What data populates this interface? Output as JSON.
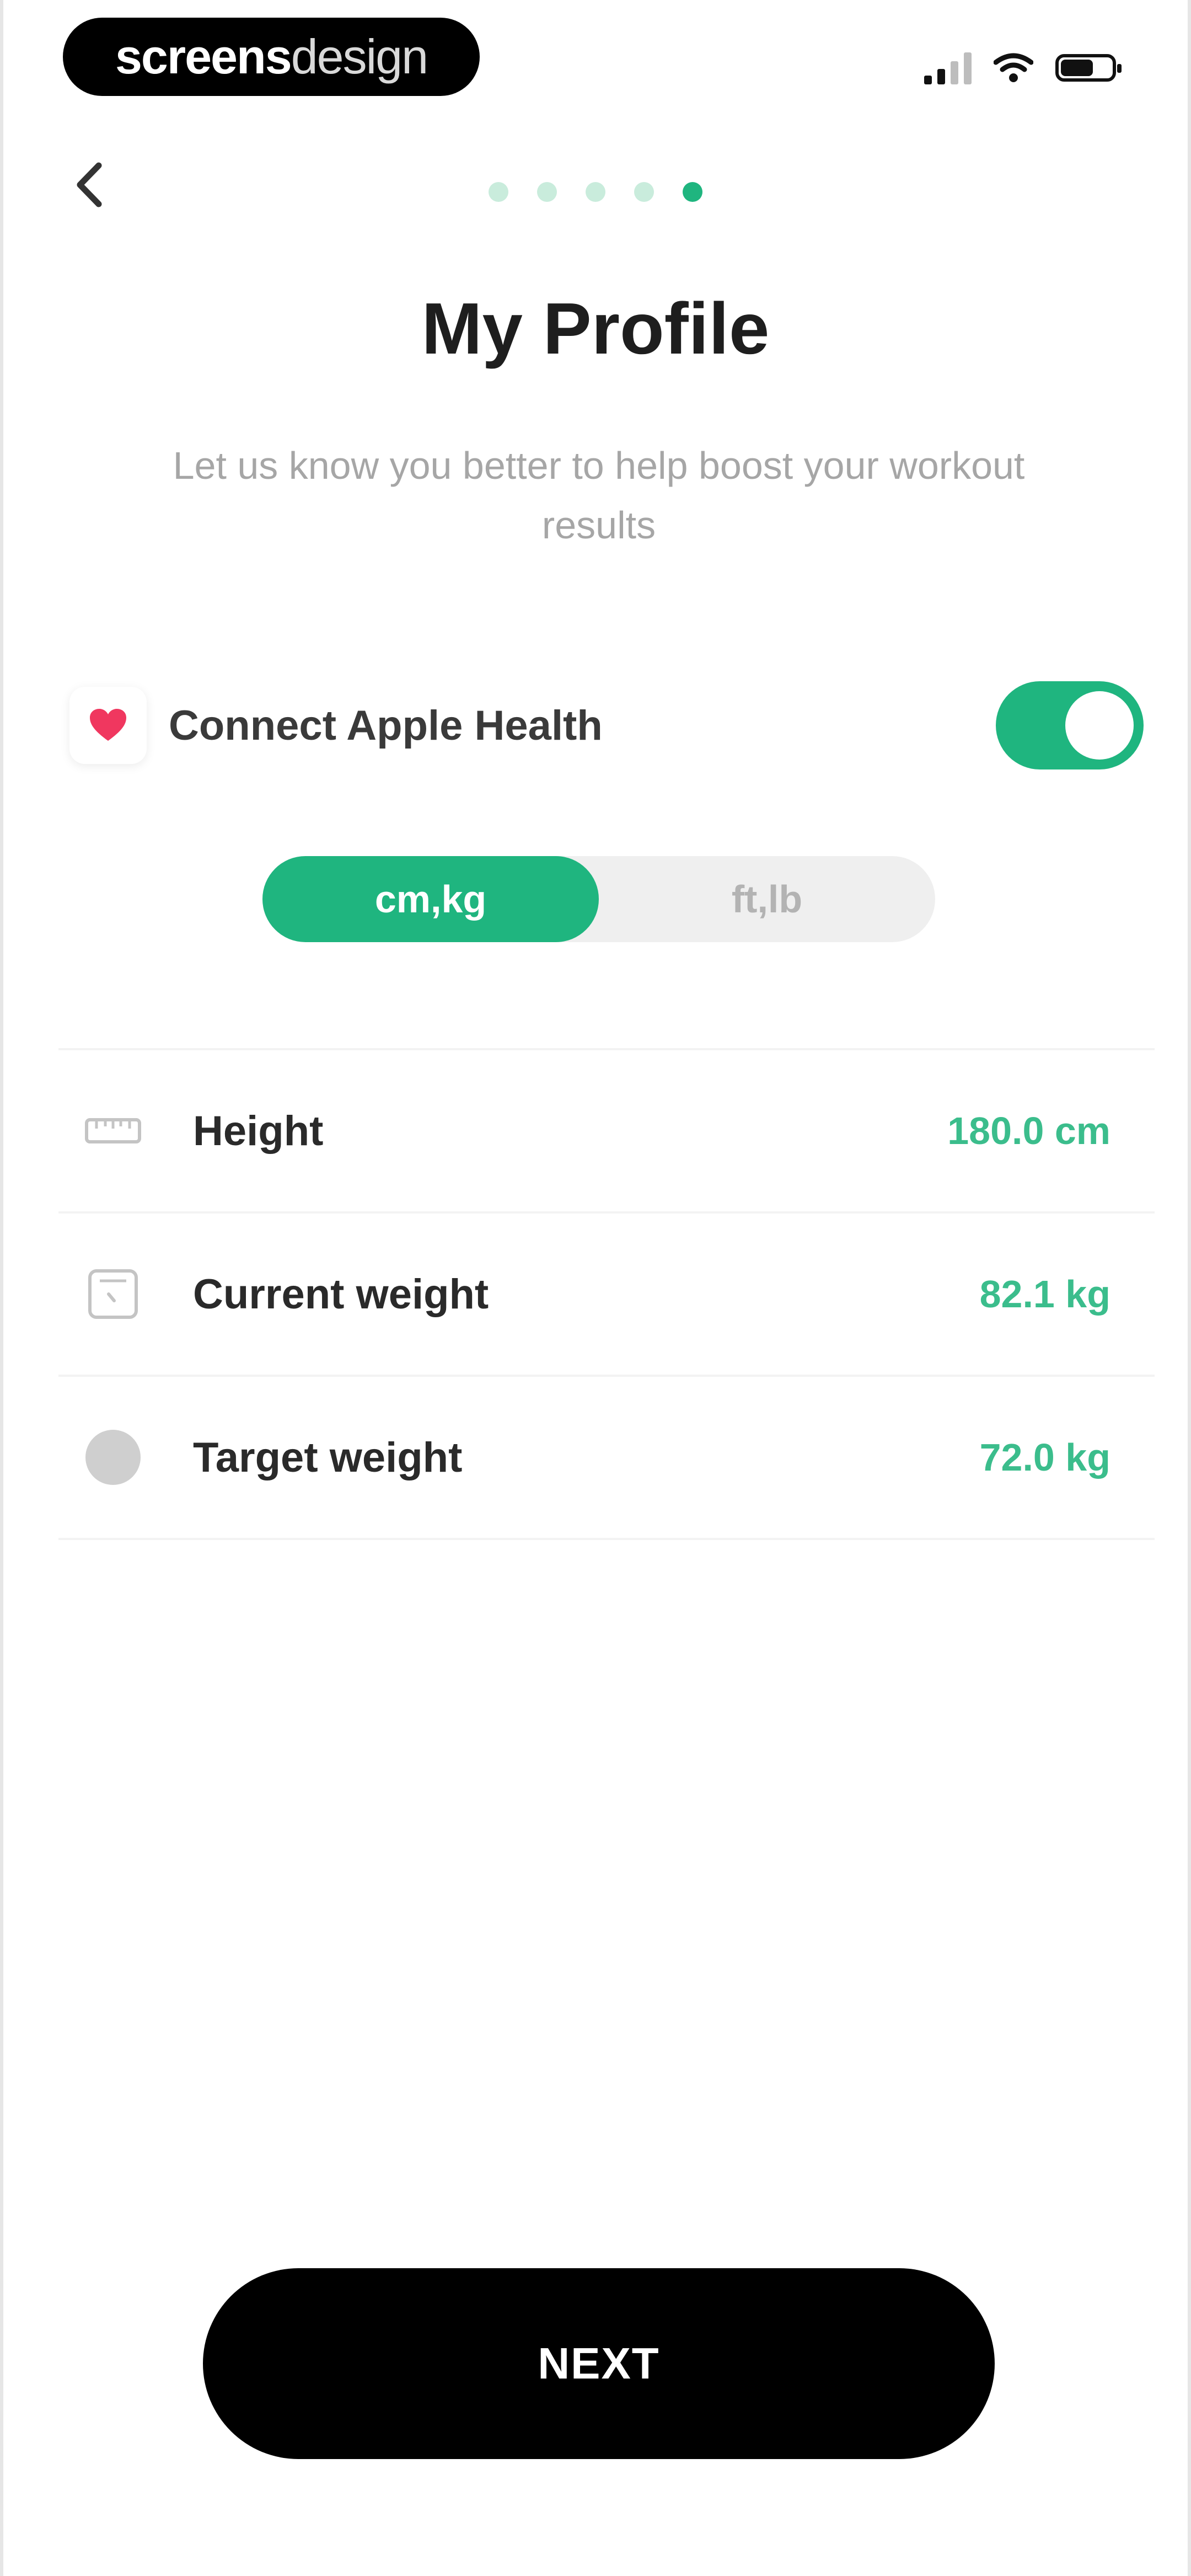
{
  "status_bar": {
    "brand_bold": "screens",
    "brand_light": "design"
  },
  "progress": {
    "total_steps": 5,
    "current_step": 5
  },
  "header": {
    "title": "My Profile",
    "subtitle": "Let us know you better to help boost your workout results"
  },
  "apple_health": {
    "label": "Connect Apple Health",
    "enabled": true
  },
  "units": {
    "options": [
      "cm,kg",
      "ft,lb"
    ],
    "selected": "cm,kg"
  },
  "metrics": [
    {
      "label": "Height",
      "value": "180.0 cm",
      "icon": "ruler-icon"
    },
    {
      "label": "Current weight",
      "value": "82.1 kg",
      "icon": "scale-icon"
    },
    {
      "label": "Target weight",
      "value": "72.0 kg",
      "icon": "target-icon"
    }
  ],
  "next_label": "NEXT",
  "colors": {
    "accent": "#1fb57f",
    "value_text": "#3bbd8c",
    "primary_button": "#000000"
  }
}
